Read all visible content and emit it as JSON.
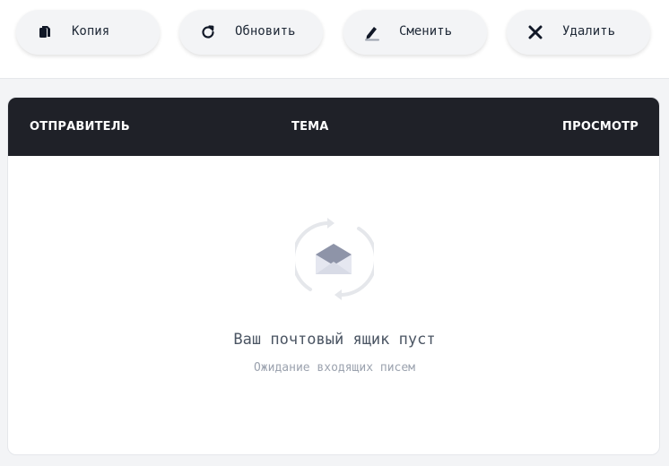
{
  "toolbar": {
    "buttons": [
      {
        "label": "Копия",
        "icon": "copy-icon"
      },
      {
        "label": "Обновить",
        "icon": "refresh-icon"
      },
      {
        "label": "Сменить",
        "icon": "edit-icon"
      },
      {
        "label": "Удалить",
        "icon": "close-icon"
      }
    ]
  },
  "table": {
    "columns": [
      "ОТПРАВИТЕЛЬ",
      "ТЕМА",
      "ПРОСМОТР"
    ]
  },
  "empty_state": {
    "icon": "envelope-refresh-icon",
    "title": "Ваш почтовый ящик пуст",
    "subtitle": "Ожидание входящих писем"
  },
  "colors": {
    "header_bg": "#1f2128",
    "button_bg": "#f3f4f6",
    "icon_muted": "#9ca3af"
  }
}
